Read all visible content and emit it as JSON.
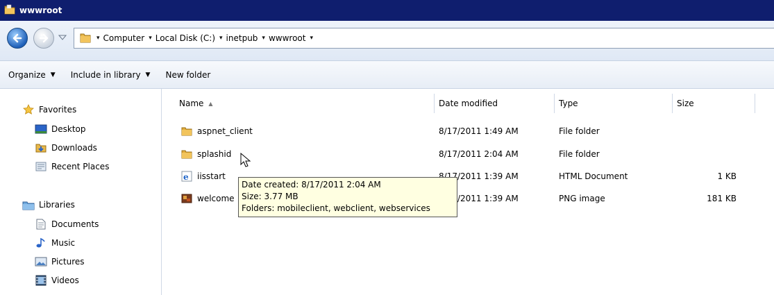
{
  "window": {
    "title": "wwwroot"
  },
  "address": {
    "crumbs": [
      "Computer",
      "Local Disk (C:)",
      "inetpub",
      "wwwroot"
    ]
  },
  "toolbar": {
    "organize": "Organize",
    "include_in_library": "Include in library",
    "new_folder": "New folder"
  },
  "nav": {
    "favorites": "Favorites",
    "desktop": "Desktop",
    "downloads": "Downloads",
    "recent_places": "Recent Places",
    "libraries": "Libraries",
    "documents": "Documents",
    "music": "Music",
    "pictures": "Pictures",
    "videos": "Videos"
  },
  "columns": {
    "name": "Name",
    "date_modified": "Date modified",
    "type": "Type",
    "size": "Size"
  },
  "files": [
    {
      "name": "aspnet_client",
      "date": "8/17/2011 1:49 AM",
      "type": "File folder",
      "size": "",
      "icon": "folder-icon"
    },
    {
      "name": "splashid",
      "date": "8/17/2011 2:04 AM",
      "type": "File folder",
      "size": "",
      "icon": "folder-icon"
    },
    {
      "name": "iisstart",
      "date": "8/17/2011 1:39 AM",
      "type": "HTML Document",
      "size": "1 KB",
      "icon": "ie-html-icon"
    },
    {
      "name": "welcome",
      "date": "8/17/2011 1:39 AM",
      "type": "PNG image",
      "size": "181 KB",
      "icon": "png-image-icon"
    }
  ],
  "tooltip": {
    "line1": "Date created: 8/17/2011 2:04 AM",
    "line2": "Size: 3.77 MB",
    "line3": "Folders: mobileclient, webclient, webservices"
  }
}
